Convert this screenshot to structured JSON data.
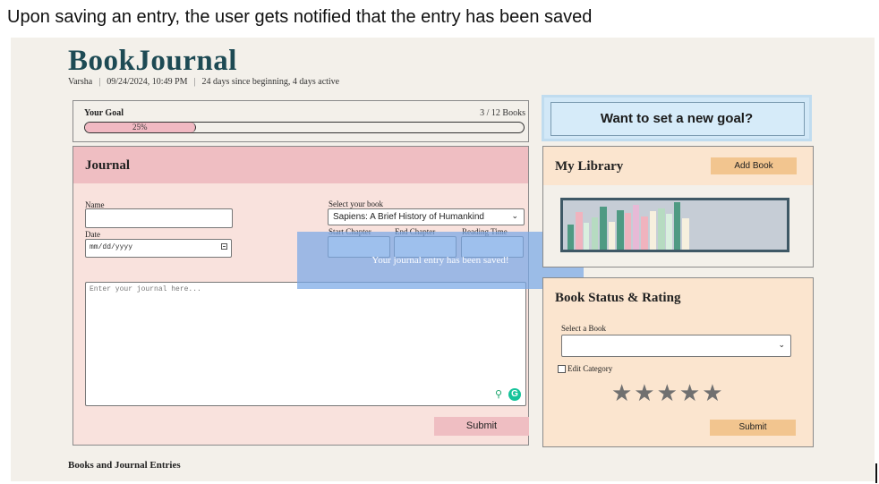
{
  "caption": "Upon saving an entry, the user gets notified that the entry has been saved",
  "header": {
    "app_name": "BookJournal",
    "user": "Varsha",
    "datetime": "09/24/2024, 10:49 PM",
    "activity": "24 days since beginning, 4 days active"
  },
  "goal": {
    "title": "Your Goal",
    "count": "3 / 12 Books",
    "progress_label": "25%",
    "progress_value": 0.25,
    "new_goal_label": "Want to set a new goal?"
  },
  "journal": {
    "title": "Journal",
    "name_label": "Name",
    "name_value": "",
    "date_label": "Date",
    "date_placeholder": "mm/dd/yyyy",
    "book_label": "Select your book",
    "book_value": "Sapiens: A Brief History of Humankind",
    "start_chapter_label": "Start Chapter",
    "end_chapter_label": "End Chapter",
    "reading_time_label": "Reading Time",
    "entry_placeholder": "Enter your journal here...",
    "submit_label": "Submit"
  },
  "toast": {
    "message": "Your journal entry has been saved!"
  },
  "library": {
    "title": "My Library",
    "add_book_label": "Add Book",
    "book_colors": [
      "#4f9a83",
      "#f0b3be",
      "#d9efdf",
      "#b6dbc1",
      "#4f9a83",
      "#f6f0de",
      "#4f9a83",
      "#f0b3be",
      "#e7b9d6",
      "#f0b3be",
      "#f6f0de",
      "#b6dbc1",
      "#d9efdf",
      "#4f9a83",
      "#f6f0de"
    ]
  },
  "status": {
    "title": "Book Status & Rating",
    "select_label": "Select a Book",
    "select_value": "",
    "edit_category_label": "Edit Category",
    "rating_stars": "★★★★★",
    "submit_label": "Submit"
  },
  "footer": {
    "section_title": "Books and Journal Entries"
  },
  "colors": {
    "brand": "#1d4a54",
    "journal_header": "#efbec2",
    "journal_body": "#f9e2dd",
    "library_header": "#fbe5cf",
    "accent_orange": "#f2c58f",
    "toast": "#78a8e6",
    "new_goal": "#d2e8f7"
  }
}
